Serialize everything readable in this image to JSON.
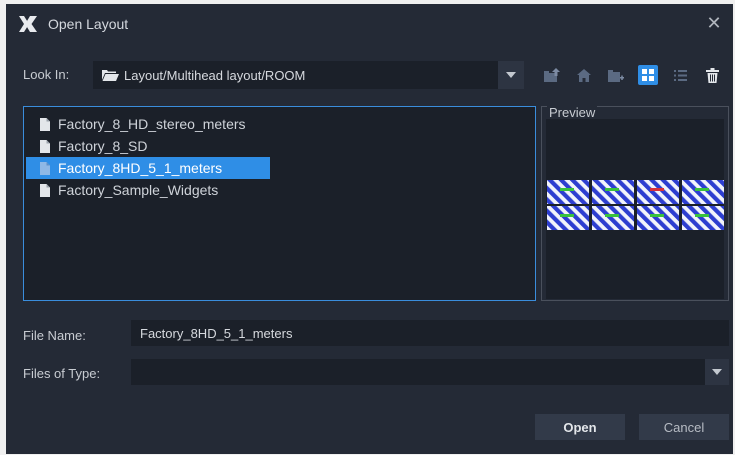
{
  "window": {
    "title": "Open Layout",
    "close_glyph": "✕",
    "logo_icon": "app-x-logo-icon"
  },
  "lookin": {
    "label": "Look In:",
    "path": "Layout/Multihead layout/ROOM",
    "folder_icon": "folder-open-icon"
  },
  "toolbar": {
    "buttons": [
      {
        "name": "up-folder-icon",
        "active": false
      },
      {
        "name": "home-icon",
        "active": false
      },
      {
        "name": "new-folder-icon",
        "active": false
      },
      {
        "name": "grid-view-icon",
        "active": true
      },
      {
        "name": "list-view-icon",
        "active": false
      },
      {
        "name": "delete-icon",
        "active": false
      }
    ],
    "accent_color": "#2f8ee6"
  },
  "files": {
    "items": [
      {
        "label": "Factory_8_HD_stereo_meters",
        "selected": false
      },
      {
        "label": "Factory_8_SD",
        "selected": false
      },
      {
        "label": "Factory_8HD_5_1_meters",
        "selected": true
      },
      {
        "label": "Factory_Sample_Widgets",
        "selected": false
      }
    ]
  },
  "preview": {
    "label": "Preview",
    "thumbnail": "multihead-grid-2x4"
  },
  "form": {
    "file_name_label": "File Name:",
    "file_name_value": "Factory_8HD_5_1_meters",
    "files_type_label": "Files of Type:",
    "files_type_value": ""
  },
  "buttons": {
    "open": "Open",
    "cancel": "Cancel"
  }
}
